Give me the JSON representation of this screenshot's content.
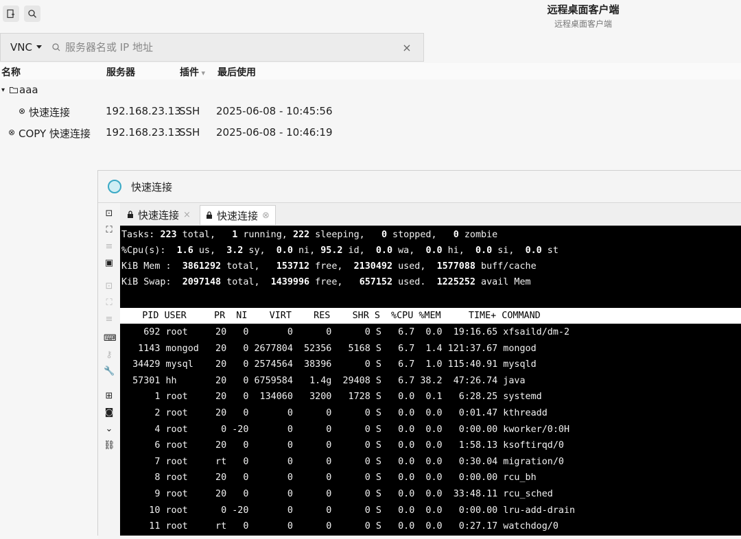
{
  "header": {
    "title": "远程桌面客户端",
    "subtitle": "远程桌面客户端",
    "new_icon": "new-connection-icon",
    "search_icon": "search-icon"
  },
  "search": {
    "protocol": "VNC",
    "placeholder": "服务器名或 IP 地址"
  },
  "columns": {
    "name": "名称",
    "server": "服务器",
    "plugin": "插件",
    "last_used": "最后使用"
  },
  "list": {
    "group": "aaa",
    "items": [
      {
        "name": "快速连接",
        "server": "192.168.23.13",
        "plugin": "SSH",
        "last_used": "2025-06-08 - 10:45:56"
      },
      {
        "name": "COPY 快速连接",
        "server": "192.168.23.13",
        "plugin": "SSH",
        "last_used": "2025-06-08 - 10:46:19"
      }
    ]
  },
  "remote": {
    "title": "快速连接",
    "tabs": [
      {
        "label": "快速连接",
        "active": false
      },
      {
        "label": "快速连接",
        "active": true
      }
    ]
  },
  "terminal": {
    "summary": {
      "tasks": {
        "total": "223",
        "running": "1",
        "sleeping": "222",
        "stopped": "0",
        "zombie": "0"
      },
      "cpu": {
        "us": "1.6",
        "sy": "3.2",
        "ni": "0.0",
        "id": "95.2",
        "wa": "0.0",
        "hi": "0.0",
        "si": "0.0",
        "st": "0.0"
      },
      "mem": {
        "total": "3861292",
        "free": "153712",
        "used": "2130492",
        "buff": "1577088"
      },
      "swap": {
        "total": "2097148",
        "free": "1439996",
        "used": "657152",
        "avail": "1225252"
      }
    },
    "columns": [
      "PID",
      "USER",
      "PR",
      "NI",
      "VIRT",
      "RES",
      "SHR",
      "S",
      "%CPU",
      "%MEM",
      "TIME+",
      "COMMAND"
    ],
    "processes": [
      [
        "692",
        "root",
        "20",
        "0",
        "0",
        "0",
        "0",
        "S",
        "6.7",
        "0.0",
        "19:16.65",
        "xfsaild/dm-2"
      ],
      [
        "1143",
        "mongod",
        "20",
        "0",
        "2677804",
        "52356",
        "5168",
        "S",
        "6.7",
        "1.4",
        "121:37.67",
        "mongod"
      ],
      [
        "34429",
        "mysql",
        "20",
        "0",
        "2574564",
        "38396",
        "0",
        "S",
        "6.7",
        "1.0",
        "115:40.91",
        "mysqld"
      ],
      [
        "57301",
        "hh",
        "20",
        "0",
        "6759584",
        "1.4g",
        "29408",
        "S",
        "6.7",
        "38.2",
        "47:26.74",
        "java"
      ],
      [
        "1",
        "root",
        "20",
        "0",
        "134060",
        "3200",
        "1728",
        "S",
        "0.0",
        "0.1",
        "6:28.25",
        "systemd"
      ],
      [
        "2",
        "root",
        "20",
        "0",
        "0",
        "0",
        "0",
        "S",
        "0.0",
        "0.0",
        "0:01.47",
        "kthreadd"
      ],
      [
        "4",
        "root",
        "0",
        "-20",
        "0",
        "0",
        "0",
        "S",
        "0.0",
        "0.0",
        "0:00.00",
        "kworker/0:0H"
      ],
      [
        "6",
        "root",
        "20",
        "0",
        "0",
        "0",
        "0",
        "S",
        "0.0",
        "0.0",
        "1:58.13",
        "ksoftirqd/0"
      ],
      [
        "7",
        "root",
        "rt",
        "0",
        "0",
        "0",
        "0",
        "S",
        "0.0",
        "0.0",
        "0:30.04",
        "migration/0"
      ],
      [
        "8",
        "root",
        "20",
        "0",
        "0",
        "0",
        "0",
        "S",
        "0.0",
        "0.0",
        "0:00.00",
        "rcu_bh"
      ],
      [
        "9",
        "root",
        "20",
        "0",
        "0",
        "0",
        "0",
        "S",
        "0.0",
        "0.0",
        "33:48.11",
        "rcu_sched"
      ],
      [
        "10",
        "root",
        "0",
        "-20",
        "0",
        "0",
        "0",
        "S",
        "0.0",
        "0.0",
        "0:00.00",
        "lru-add-drain"
      ],
      [
        "11",
        "root",
        "rt",
        "0",
        "0",
        "0",
        "0",
        "S",
        "0.0",
        "0.0",
        "0:27.17",
        "watchdog/0"
      ]
    ]
  }
}
